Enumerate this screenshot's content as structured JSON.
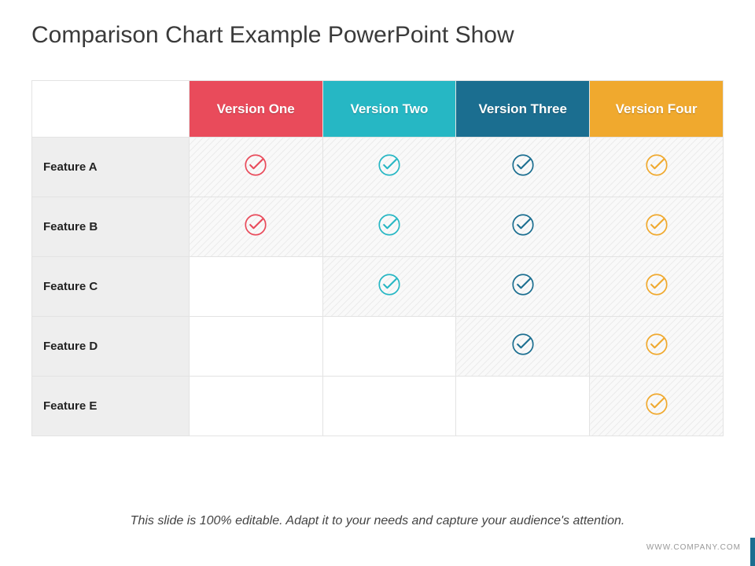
{
  "title": "Comparison Chart Example PowerPoint Show",
  "footnote": "This slide is 100% editable. Adapt it to your needs and capture your audience's attention.",
  "url": "WWW.COMPANY.COM",
  "versions": [
    {
      "label": "Version One",
      "color": "#e94b5b"
    },
    {
      "label": "Version Two",
      "color": "#26b7c4"
    },
    {
      "label": "Version Three",
      "color": "#1b6e90"
    },
    {
      "label": "Version Four",
      "color": "#f0a92e"
    }
  ],
  "features": [
    {
      "label": "Feature A"
    },
    {
      "label": "Feature B"
    },
    {
      "label": "Feature C"
    },
    {
      "label": "Feature D"
    },
    {
      "label": "Feature E"
    }
  ],
  "chart_data": {
    "type": "table",
    "title": "Comparison Chart Example PowerPoint Show",
    "columns": [
      "Version One",
      "Version Two",
      "Version Three",
      "Version Four"
    ],
    "rows": [
      "Feature A",
      "Feature B",
      "Feature C",
      "Feature D",
      "Feature E"
    ],
    "values": [
      [
        true,
        true,
        true,
        true
      ],
      [
        true,
        true,
        true,
        true
      ],
      [
        false,
        true,
        true,
        true
      ],
      [
        false,
        false,
        true,
        true
      ],
      [
        false,
        false,
        false,
        true
      ]
    ],
    "column_colors": [
      "#e94b5b",
      "#26b7c4",
      "#1b6e90",
      "#f0a92e"
    ]
  }
}
